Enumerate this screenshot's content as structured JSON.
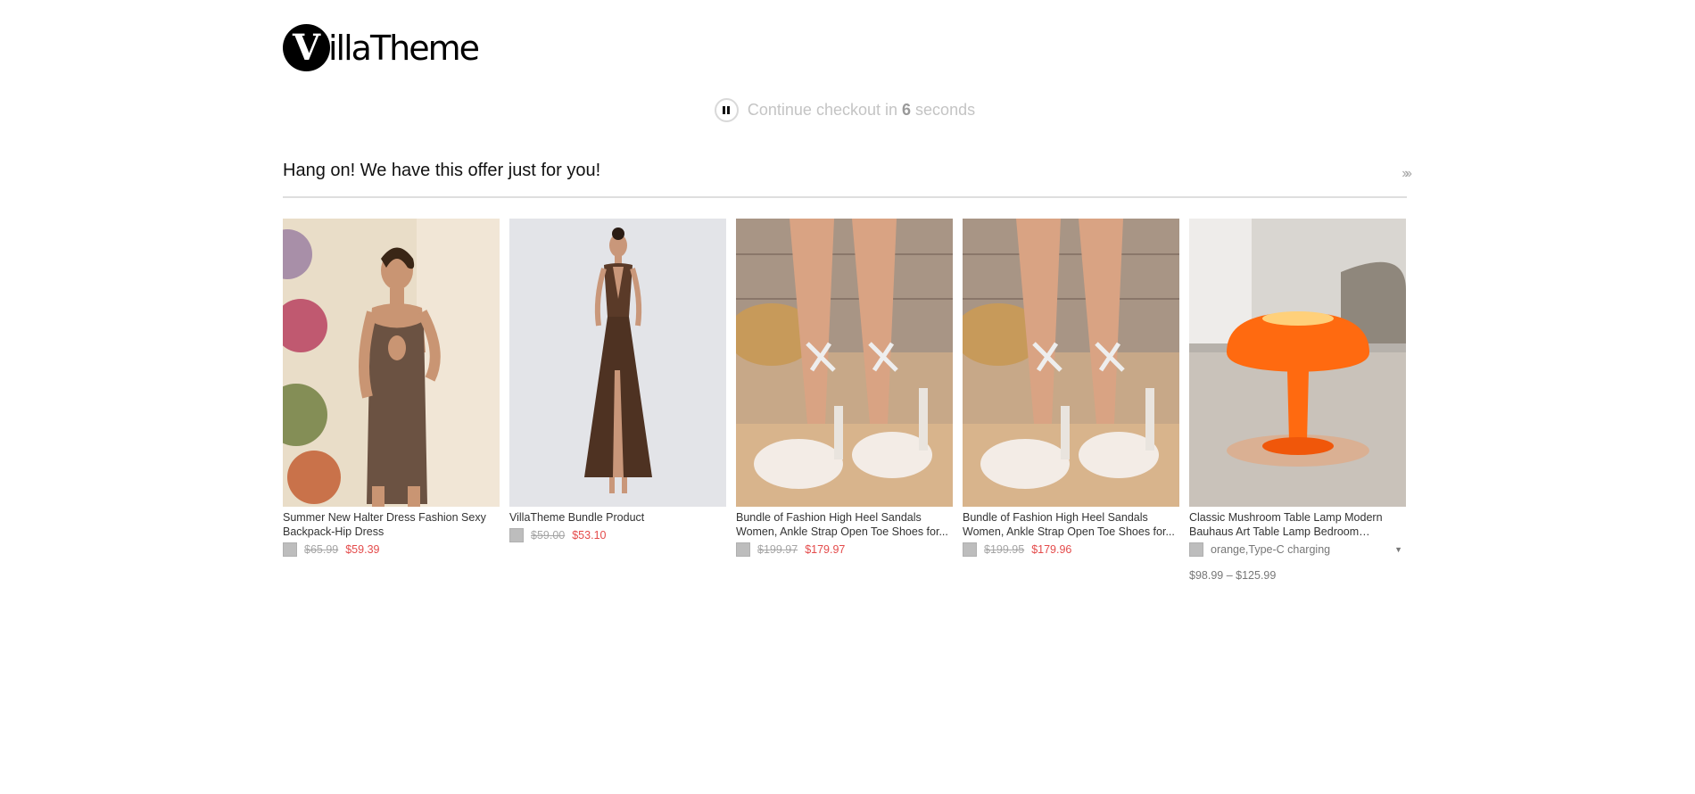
{
  "logo": {
    "letter": "V",
    "text": "illaTheme"
  },
  "countdown": {
    "prefix": "Continue checkout in",
    "seconds": "6",
    "suffix": "seconds"
  },
  "offer": {
    "title": "Hang on! We have this offer just for you!",
    "skip_glyph": "»»"
  },
  "products": [
    {
      "name": "Summer New Halter Dress Fashion Sexy Backpack-Hip Dress",
      "old_price": "$65.99",
      "new_price": "$59.39"
    },
    {
      "name": "VillaTheme Bundle Product",
      "old_price": "$59.00",
      "new_price": "$53.10"
    },
    {
      "name": "Bundle of Fashion High Heel Sandals Women, Ankle Strap Open Toe Shoes for...",
      "old_price": "$199.97",
      "new_price": "$179.97"
    },
    {
      "name": "Bundle of Fashion High Heel Sandals Women, Ankle Strap Open Toe Shoes for...",
      "old_price": "$199.95",
      "new_price": "$179.96"
    },
    {
      "name": "Classic Mushroom Table Lamp Modern Bauhaus Art Table Lamp Bedroom Bedside...",
      "variant": "orange,Type-C charging",
      "price_range": "$98.99 – $125.99"
    }
  ],
  "colors": {
    "sale": "#e44b4b",
    "muted": "#a5a5a5",
    "divider": "#dedede",
    "lamp": "#ff6a10"
  }
}
